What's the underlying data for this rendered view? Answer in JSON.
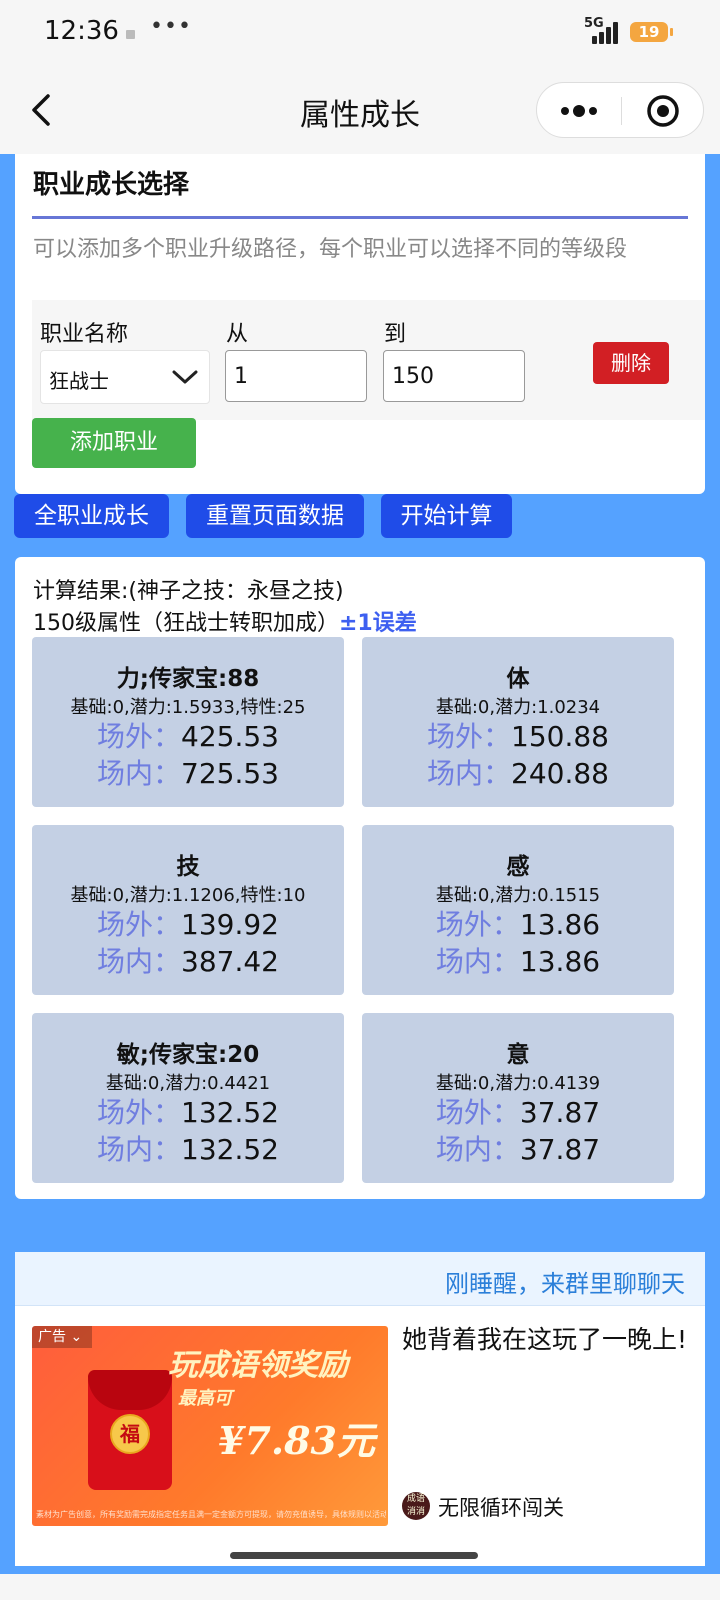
{
  "status_bar": {
    "time": "12:36",
    "more": "•••",
    "network": "5G",
    "battery": "19"
  },
  "nav": {
    "title": "属性成长"
  },
  "job_section": {
    "title": "职业成长选择",
    "description": "可以添加多个职业升级路径，每个职业可以选择不同的等级段",
    "job_label": "职业名称",
    "from_label": "从",
    "to_label": "到",
    "job_value": "狂战士",
    "from_value": "1",
    "to_value": "150",
    "delete_label": "删除",
    "add_label": "添加职业"
  },
  "actions": {
    "all_jobs": "全职业成长",
    "reset": "重置页面数据",
    "calculate": "开始计算"
  },
  "results": {
    "line1": "计算结果:(神子之技：永昼之技)",
    "line2": "150级属性（狂战士转职加成）",
    "error_note": "±1误差",
    "outside_label": "场外：",
    "inside_label": "场内：",
    "stats": [
      {
        "name": "力;传家宝:88",
        "base": "基础:0,潜力:1.5933,特性:25",
        "outside": "425.53",
        "inside": "725.53"
      },
      {
        "name": "体",
        "base": "基础:0,潜力:1.0234",
        "outside": "150.88",
        "inside": "240.88"
      },
      {
        "name": "技",
        "base": "基础:0,潜力:1.1206,特性:10",
        "outside": "139.92",
        "inside": "387.42"
      },
      {
        "name": "感",
        "base": "基础:0,潜力:0.1515",
        "outside": "13.86",
        "inside": "13.86"
      },
      {
        "name": "敏;传家宝:20",
        "base": "基础:0,潜力:0.4421",
        "outside": "132.52",
        "inside": "132.52"
      },
      {
        "name": "意",
        "base": "基础:0,潜力:0.4139",
        "outside": "37.87",
        "inside": "37.87"
      }
    ]
  },
  "ticker": {
    "text": "刚睡醒，来群里聊聊天"
  },
  "ad": {
    "tag": "广告",
    "headline": "玩成语领奖励",
    "sub": "最高可",
    "amount": "¥7.83元",
    "envelope_char": "福",
    "fine_print": "素材为广告创意，所有奖励需完成指定任务且满一定金额方可提现，请勿充值诱导，具体规则以活动页面为准",
    "title": "她背着我在这玩了一晚上!",
    "source_logo": "成语 消消",
    "source": "无限循环闯关"
  },
  "colors": {
    "page_blue": "#55a2ff",
    "action_blue": "#1f4ce8",
    "delete_red": "#d21f24",
    "add_green": "#46b24c",
    "stat_card": "#c4d0e4",
    "stat_key": "#6f7ee0"
  }
}
